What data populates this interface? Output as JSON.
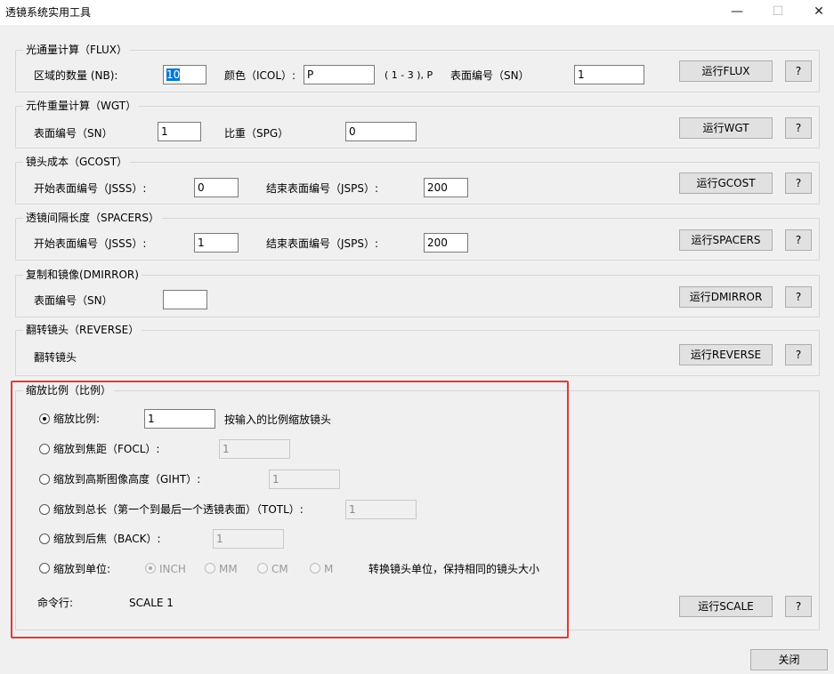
{
  "window": {
    "title": "透镜系统实用工具",
    "minimize": "—",
    "maximize": "☐",
    "close": "✕"
  },
  "flux": {
    "legend": "光通量计算（FLUX）",
    "nb_label": "区域的数量 (NB):",
    "nb_value": "10",
    "icol_label": "颜色（ICOL）:",
    "icol_value": "P",
    "icol_hint": "( 1 - 3 ), P",
    "sn_label": "表面编号（SN）",
    "sn_value": "1",
    "run": "运行FLUX",
    "help": "?"
  },
  "wgt": {
    "legend": "元件重量计算（WGT）",
    "sn_label": "表面编号（SN）",
    "sn_value": "1",
    "spg_label": "比重（SPG）",
    "spg_value": "0",
    "run": "运行WGT",
    "help": "?"
  },
  "gcost": {
    "legend": "镜头成本（GCOST）",
    "jsss_label": "开始表面编号（JSSS）:",
    "jsss_value": "0",
    "jsps_label": "结束表面编号（JSPS）:",
    "jsps_value": "200",
    "run": "运行GCOST",
    "help": "?"
  },
  "spacers": {
    "legend": "透镜间隔长度（SPACERS）",
    "jsss_label": "开始表面编号（JSSS）:",
    "jsss_value": "1",
    "jsps_label": "结束表面编号（JSPS）:",
    "jsps_value": "200",
    "run": "运行SPACERS",
    "help": "?"
  },
  "dmirror": {
    "legend": "复制和镜像(DMIRROR)",
    "sn_label": "表面编号（SN）",
    "sn_value": "",
    "run": "运行DMIRROR",
    "help": "?"
  },
  "reverse": {
    "legend": "翻转镜头（REVERSE）",
    "text": "翻转镜头",
    "run": "运行REVERSE",
    "help": "?"
  },
  "scale": {
    "legend": "缩放比例（比例）",
    "opt_ratio": "缩放比例:",
    "ratio_value": "1",
    "ratio_hint": "按输入的比例缩放镜头",
    "opt_focl": "缩放到焦距（FOCL）:",
    "focl_value": "1",
    "opt_giht": "缩放到高斯图像高度（GIHT）:",
    "giht_value": "1",
    "opt_totl": "缩放到总长（第一个到最后一个透镜表面）（TOTL）:",
    "totl_value": "1",
    "opt_back": "缩放到后焦（BACK）:",
    "back_value": "1",
    "opt_units": "缩放到单位:",
    "unit_inch": "INCH",
    "unit_mm": "MM",
    "unit_cm": "CM",
    "unit_m": "M",
    "units_hint": "转换镜头单位，保持相同的镜头大小",
    "cmd_label": "命令行:",
    "cmd_value": "SCALE 1",
    "run": "运行SCALE",
    "help": "?"
  },
  "close_button": "关闭",
  "colors": {
    "highlight_border": "#e53935",
    "selection": "#0078d7",
    "window_bg": "#f0f0f0"
  }
}
